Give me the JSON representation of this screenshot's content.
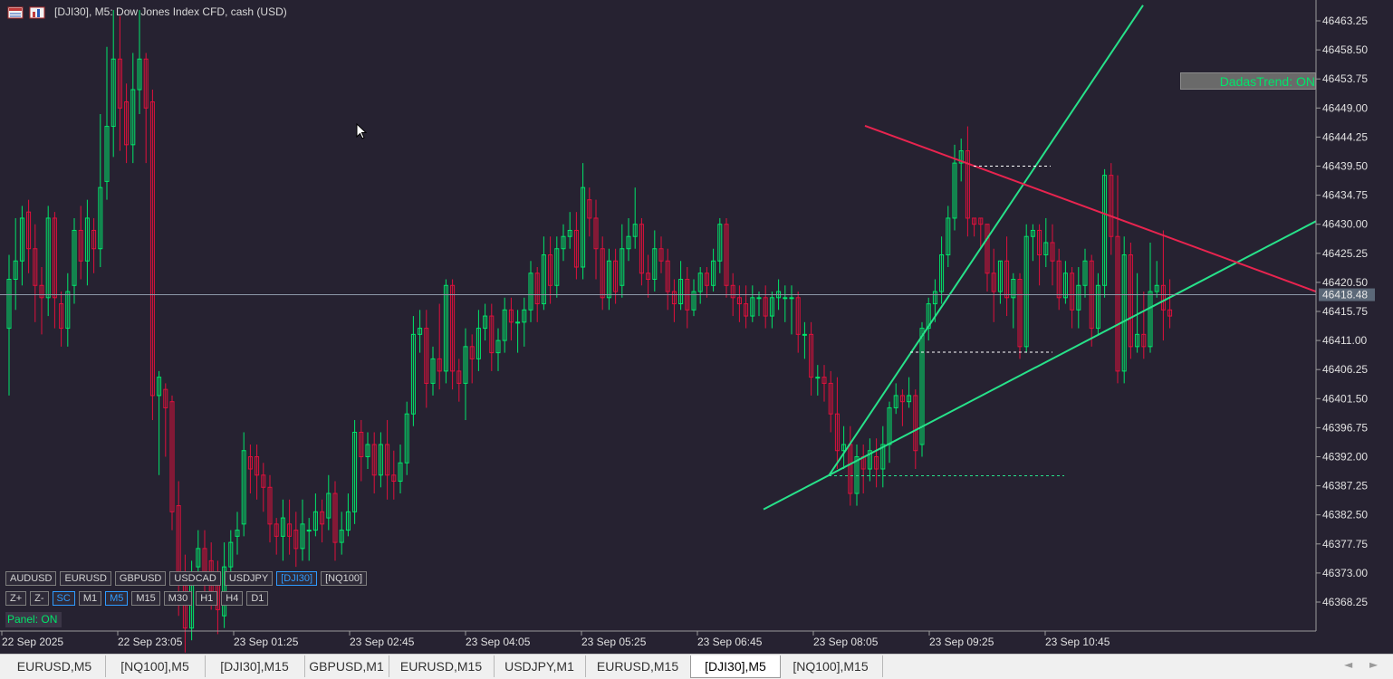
{
  "window": {
    "title": "[DJI30], M5:  Dow Jones Index CFD, cash (USD)"
  },
  "indicator": {
    "label": "DadasTrend: ON"
  },
  "chart_data": {
    "type": "candlestick",
    "symbol": "[DJI30]",
    "timeframe": "M5",
    "y_ticks": [
      "46463.25",
      "46458.50",
      "46453.75",
      "46449.00",
      "46444.25",
      "46439.50",
      "46434.75",
      "46430.00",
      "46425.25",
      "46420.50",
      "46415.75",
      "46411.00",
      "46406.25",
      "46401.50",
      "46396.75",
      "46392.00",
      "46387.25",
      "46382.50",
      "46377.75",
      "46373.00",
      "46368.25"
    ],
    "y_range": [
      46363.8,
      46465.8
    ],
    "current_price": "46418.48",
    "x_labels": [
      "22 Sep 2025",
      "22 Sep 23:05",
      "23 Sep 01:25",
      "23 Sep 02:45",
      "23 Sep 04:05",
      "23 Sep 05:25",
      "23 Sep 06:45",
      "23 Sep 08:05",
      "23 Sep 09:25",
      "23 Sep 10:45"
    ],
    "colors": {
      "up": "#00e56a",
      "down": "#e0103c",
      "background": "#262231",
      "grid_line": "#8c98a8",
      "fork": "#27e28a",
      "resistance": "#e8244f"
    },
    "candles": [
      [
        46413,
        46421,
        46402,
        46425
      ],
      [
        46421,
        46424,
        46416,
        46431
      ],
      [
        46424,
        46431,
        46420,
        46433
      ],
      [
        46432,
        46426,
        46422,
        46434
      ],
      [
        46426,
        46420,
        46414,
        46430
      ],
      [
        46420,
        46418,
        46412,
        46423
      ],
      [
        46418,
        46431,
        46415,
        46433
      ],
      [
        46431,
        46418,
        46413,
        46432
      ],
      [
        46417,
        46413,
        46410,
        46419
      ],
      [
        46413,
        46419,
        46410,
        46422
      ],
      [
        46420,
        46429,
        46417,
        46431
      ],
      [
        46429,
        46424,
        46421,
        46433
      ],
      [
        46424,
        46431,
        46420,
        46434
      ],
      [
        46429,
        46426,
        46422,
        46431
      ],
      [
        46426,
        46436,
        46423,
        46448
      ],
      [
        46437,
        46446,
        46434,
        46459
      ],
      [
        46446,
        46457,
        46441,
        46465
      ],
      [
        46457,
        46449,
        46442,
        46464
      ],
      [
        46450,
        46443,
        46440,
        46453
      ],
      [
        46443,
        46452,
        46440,
        46458
      ],
      [
        46452,
        46457,
        46448,
        46465
      ],
      [
        46457,
        46449,
        46440,
        46458
      ],
      [
        46450,
        46402,
        46398,
        46452
      ],
      [
        46402,
        46405,
        46389,
        46406
      ],
      [
        46403,
        46400,
        46392,
        46404
      ],
      [
        46401,
        46383,
        46380,
        46402
      ],
      [
        46384,
        46371,
        46366,
        46388
      ],
      [
        46372,
        46364,
        46360,
        46376
      ],
      [
        46364,
        46372,
        46362,
        46375
      ],
      [
        46374,
        46377,
        46371,
        46380
      ],
      [
        46377,
        46373,
        46369,
        46380
      ],
      [
        46375,
        46370,
        46367,
        46378
      ],
      [
        46371,
        46367,
        46363,
        46375
      ],
      [
        46366,
        46374,
        46364,
        46378
      ],
      [
        46374,
        46378,
        46371,
        46380
      ],
      [
        46379,
        46380,
        46376,
        46383
      ],
      [
        46381,
        46393,
        46379,
        46396
      ],
      [
        46392,
        46390,
        46386,
        46394
      ],
      [
        46392,
        46389,
        46385,
        46394
      ],
      [
        46389,
        46387,
        46383,
        46391
      ],
      [
        46387,
        46381,
        46378,
        46389
      ],
      [
        46381,
        46379,
        46376,
        46382
      ],
      [
        46379,
        46382,
        46375,
        46385
      ],
      [
        46381,
        46379,
        46376,
        46385
      ],
      [
        46380,
        46377,
        46374,
        46383
      ],
      [
        46377,
        46381,
        46375,
        46385
      ],
      [
        46380,
        46380,
        46375,
        46382
      ],
      [
        46380,
        46383,
        46379,
        46386
      ],
      [
        46383,
        46381,
        46378,
        46385
      ],
      [
        46382,
        46386,
        46380,
        46389
      ],
      [
        46386,
        46378,
        46375,
        46388
      ],
      [
        46378,
        46380,
        46376,
        46383
      ],
      [
        46380,
        46383,
        46379,
        46386
      ],
      [
        46383,
        46396,
        46381,
        46398
      ],
      [
        46396,
        46392,
        46388,
        46398
      ],
      [
        46392,
        46394,
        46390,
        46396
      ],
      [
        46394,
        46389,
        46386,
        46396
      ],
      [
        46389,
        46394,
        46387,
        46396
      ],
      [
        46394,
        46389,
        46385,
        46398
      ],
      [
        46389,
        46388,
        46385,
        46393
      ],
      [
        46388,
        46391,
        46386,
        46394
      ],
      [
        46391,
        46399,
        46389,
        46401
      ],
      [
        46399,
        46412,
        46397,
        46415
      ],
      [
        46412,
        46413,
        46409,
        46416
      ],
      [
        46413,
        46404,
        46400,
        46416
      ],
      [
        46404,
        46408,
        46402,
        46410
      ],
      [
        46408,
        46406,
        46403,
        46417
      ],
      [
        46406,
        46420,
        46404,
        46421
      ],
      [
        46420,
        46406,
        46403,
        46421
      ],
      [
        46406,
        46404,
        46401,
        46408
      ],
      [
        46404,
        46410,
        46398,
        46413
      ],
      [
        46410,
        46408,
        46404,
        46412
      ],
      [
        46408,
        46413,
        46406,
        46416
      ],
      [
        46413,
        46415,
        46411,
        46417
      ],
      [
        46415,
        46409,
        46406,
        46417
      ],
      [
        46409,
        46411,
        46406,
        46413
      ],
      [
        46411,
        46416,
        46409,
        46418
      ],
      [
        46416,
        46414,
        46411,
        46418
      ],
      [
        46414,
        46414,
        46409,
        46416
      ],
      [
        46414,
        46416,
        46410,
        46418
      ],
      [
        46416,
        46422,
        46414,
        46424
      ],
      [
        46422,
        46417,
        46414,
        46423
      ],
      [
        46417,
        46425,
        46416,
        46428
      ],
      [
        46425,
        46420,
        46417,
        46428
      ],
      [
        46420,
        46426,
        46418,
        46428
      ],
      [
        46426,
        46428,
        46424,
        46430
      ],
      [
        46428,
        46429,
        46426,
        46432
      ],
      [
        46429,
        46423,
        46421,
        46432
      ],
      [
        46423,
        46436,
        46421,
        46440
      ],
      [
        46434,
        46431,
        46428,
        46436
      ],
      [
        46431,
        46426,
        46421,
        46434
      ],
      [
        46426,
        46418,
        46416,
        46428
      ],
      [
        46418,
        46424,
        46416,
        46426
      ],
      [
        46424,
        46419,
        46417,
        46426
      ],
      [
        46420,
        46426,
        46418,
        46430
      ],
      [
        46426,
        46428,
        46424,
        46431
      ],
      [
        46428,
        46430,
        46426,
        46436
      ],
      [
        46430,
        46422,
        46420,
        46431
      ],
      [
        46422,
        46421,
        46418,
        46425
      ],
      [
        46421,
        46426,
        46419,
        46429
      ],
      [
        46426,
        46424,
        46422,
        46428
      ],
      [
        46424,
        46419,
        46416,
        46426
      ],
      [
        46419,
        46417,
        46414,
        46421
      ],
      [
        46417,
        46421,
        46416,
        46424
      ],
      [
        46421,
        46416,
        46413,
        46423
      ],
      [
        46416,
        46419,
        46415,
        46421
      ],
      [
        46419,
        46422,
        46417,
        46423
      ],
      [
        46422,
        46420,
        46418,
        46423
      ],
      [
        46420,
        46424,
        46419,
        46426
      ],
      [
        46424,
        46430,
        46422,
        46431
      ],
      [
        46430,
        46420,
        46418,
        46431
      ],
      [
        46420,
        46418,
        46415,
        46422
      ],
      [
        46418,
        46417,
        46414,
        46420
      ],
      [
        46417,
        46415,
        46413,
        46420
      ],
      [
        46415,
        46418,
        46414,
        46420
      ],
      [
        46418,
        46418,
        46415,
        46419
      ],
      [
        46418,
        46415,
        46413,
        46420
      ],
      [
        46415,
        46418,
        46413,
        46419
      ],
      [
        46418,
        46419,
        46416,
        46421
      ],
      [
        46418,
        46418,
        46414,
        46420
      ],
      [
        46418,
        46418,
        46412,
        46420
      ],
      [
        46418,
        46412,
        46409,
        46419
      ],
      [
        46412,
        46412,
        46408,
        46414
      ],
      [
        46412,
        46405,
        46402,
        46414
      ],
      [
        46405,
        46405,
        46402,
        46407
      ],
      [
        46405,
        46404,
        46401,
        46407
      ],
      [
        46404,
        46399,
        46396,
        46406
      ],
      [
        46399,
        46393,
        46390,
        46405
      ],
      [
        46393,
        46394,
        46390,
        46397
      ],
      [
        46394,
        46386,
        46384,
        46397
      ],
      [
        46386,
        46392,
        46384,
        46394
      ],
      [
        46392,
        46390,
        46386,
        46394
      ],
      [
        46390,
        46393,
        46388,
        46395
      ],
      [
        46392,
        46390,
        46387,
        46395
      ],
      [
        46390,
        46394,
        46387,
        46397
      ],
      [
        46394,
        46400,
        46391,
        46401
      ],
      [
        46400,
        46402,
        46399,
        46404
      ],
      [
        46402,
        46401,
        46397,
        46403
      ],
      [
        46401,
        46402,
        46400,
        46405
      ],
      [
        46402,
        46393,
        46390,
        46403
      ],
      [
        46394,
        46413,
        46392,
        46414
      ],
      [
        46413,
        46417,
        46411,
        46418
      ],
      [
        46417,
        46419,
        46414,
        46421
      ],
      [
        46419,
        46425,
        46417,
        46428
      ],
      [
        46425,
        46431,
        46423,
        46433
      ],
      [
        46431,
        46440,
        46429,
        46443
      ],
      [
        46440,
        46442,
        46437,
        46444
      ],
      [
        46442,
        46431,
        46428,
        46446
      ],
      [
        46431,
        46430,
        46428,
        46431
      ],
      [
        46431,
        46430,
        46426,
        46431
      ],
      [
        46430,
        46422,
        46419,
        46430
      ],
      [
        46422,
        46419,
        46414,
        46426
      ],
      [
        46419,
        46424,
        46417,
        46424
      ],
      [
        46424,
        46418,
        46415,
        46428
      ],
      [
        46418,
        46421,
        46413,
        46422
      ],
      [
        46421,
        46410,
        46408,
        46422
      ],
      [
        46410,
        46428,
        46409,
        46430
      ],
      [
        46428,
        46429,
        46424,
        46430
      ],
      [
        46429,
        46425,
        46420,
        46430
      ],
      [
        46425,
        46427,
        46423,
        46431
      ],
      [
        46427,
        46424,
        46420,
        46430
      ],
      [
        46424,
        46418,
        46416,
        46426
      ],
      [
        46418,
        46422,
        46417,
        46424
      ],
      [
        46422,
        46416,
        46413,
        46423
      ],
      [
        46416,
        46420,
        46413,
        46423
      ],
      [
        46420,
        46424,
        46418,
        46426
      ],
      [
        46424,
        46413,
        46410,
        46425
      ],
      [
        46413,
        46420,
        46412,
        46422
      ],
      [
        46420,
        46438,
        46418,
        46439
      ],
      [
        46438,
        46428,
        46425,
        46440
      ],
      [
        46428,
        46406,
        46404,
        46438
      ],
      [
        46406,
        46425,
        46404,
        46428
      ],
      [
        46425,
        46410,
        46408,
        46427
      ],
      [
        46410,
        46412,
        46409,
        46422
      ],
      [
        46412,
        46410,
        46408,
        46419
      ],
      [
        46410,
        46419,
        46409,
        46427
      ],
      [
        46419,
        46420,
        46418,
        46424
      ],
      [
        46420,
        46416,
        46411,
        46429
      ],
      [
        46416,
        46415,
        46413,
        46421
      ]
    ],
    "annotations": [
      {
        "type": "line",
        "color": "fork",
        "from": [
          843,
          46383.4
        ],
        "to": [
          1453,
          46430.5
        ]
      },
      {
        "type": "line",
        "color": "fork",
        "from": [
          915,
          46388.9
        ],
        "to": [
          1262,
          46465.8
        ]
      },
      {
        "type": "line",
        "color": "resistance",
        "from": [
          955,
          46446.1
        ],
        "to": [
          1453,
          46419.0
        ]
      },
      {
        "type": "dashed",
        "color": "#ffffff",
        "from": [
          1075,
          46439.5
        ],
        "to": [
          1160,
          46439.5
        ]
      },
      {
        "type": "dashed",
        "color": "#ffffff",
        "from": [
          1005,
          46409.1
        ],
        "to": [
          1162,
          46409.1
        ]
      },
      {
        "type": "dashed",
        "color": "fork",
        "from": [
          915,
          46388.9
        ],
        "to": [
          1175,
          46388.9
        ]
      }
    ]
  },
  "symbol_buttons": [
    {
      "label": "AUDUSD",
      "active": false
    },
    {
      "label": "EURUSD",
      "active": false
    },
    {
      "label": "GBPUSD",
      "active": false
    },
    {
      "label": "USDCAD",
      "active": false
    },
    {
      "label": "USDJPY",
      "active": false
    },
    {
      "label": "[DJI30]",
      "active": true
    },
    {
      "label": "[NQ100]",
      "active": false
    }
  ],
  "timeframe_buttons": [
    {
      "label": "Z+",
      "active": false
    },
    {
      "label": "Z-",
      "active": false
    },
    {
      "label": "SC",
      "active": true
    },
    {
      "label": "M1",
      "active": false
    },
    {
      "label": "M5",
      "active": true
    },
    {
      "label": "M15",
      "active": false
    },
    {
      "label": "M30",
      "active": false
    },
    {
      "label": "H1",
      "active": false
    },
    {
      "label": "H4",
      "active": false
    },
    {
      "label": "D1",
      "active": false
    }
  ],
  "panel": {
    "status": "Panel: ON"
  },
  "tabs": [
    {
      "label": "EURUSD,M5",
      "active": false
    },
    {
      "label": "[NQ100],M5",
      "active": false
    },
    {
      "label": "[DJI30],M15",
      "active": false
    },
    {
      "label": "GBPUSD,M1",
      "active": false
    },
    {
      "label": "EURUSD,M15",
      "active": false
    },
    {
      "label": "USDJPY,M1",
      "active": false
    },
    {
      "label": "EURUSD,M15",
      "active": false
    },
    {
      "label": "[DJI30],M5",
      "active": true
    },
    {
      "label": "[NQ100],M15",
      "active": false
    }
  ],
  "tab_nav": {
    "prev": "◄",
    "next": "►"
  },
  "icons": {
    "title_icons": [
      "chart-window-icon",
      "chart-properties-icon"
    ],
    "cursor": "mouse-pointer-icon"
  }
}
